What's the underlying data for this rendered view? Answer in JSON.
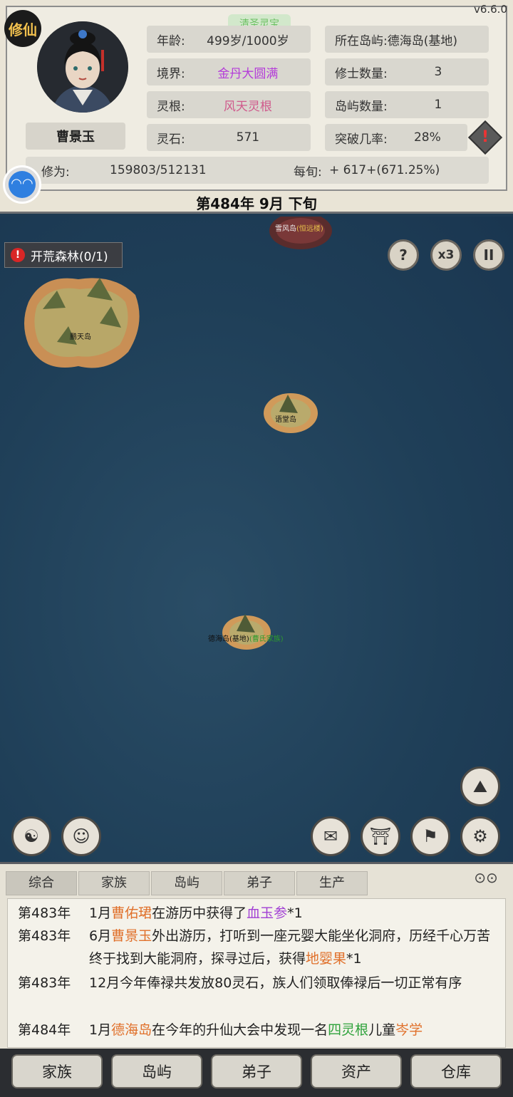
{
  "version": "v6.6.0",
  "logo": "修仙",
  "badge": "清圣灵宝",
  "character": {
    "name": "曹景玉",
    "age_label": "年龄:",
    "age_value": "499岁/1000岁",
    "realm_label": "境界:",
    "realm_value": "金丹大圆满",
    "root_label": "灵根:",
    "root_value": "风天灵根",
    "stones_label": "灵石:",
    "stones_value": "571",
    "cult_label": "修为:",
    "cult_value": "159803/512131",
    "per_label": "每旬:",
    "per_value": "+ 617+(671.25%)"
  },
  "island_info": {
    "location_label": "所在岛屿:",
    "location_value": "德海岛(基地)",
    "cultivators_label": "修士数量:",
    "cultivators_value": "3",
    "islands_label": "岛屿数量:",
    "islands_value": "1",
    "breakthrough_label": "突破几率:",
    "breakthrough_value": "28%"
  },
  "date": "第484年 9月 下旬",
  "quest": "开荒森林(0/1)",
  "map_controls": {
    "help": "?",
    "speed": "x3",
    "pause": "II"
  },
  "islands": {
    "north": "雪风岛",
    "north_tag": "(恒远楼)",
    "west": "鹏天岛",
    "mid": "语堂岛",
    "home": "德海岛(基地)",
    "home_tag": "(曹氏家族)"
  },
  "log_tabs": [
    "综合",
    "家族",
    "岛屿",
    "弟子",
    "生产"
  ],
  "log": [
    {
      "year": "第483年",
      "parts": [
        [
          "1月",
          ""
        ],
        [
          "曹佑珺",
          "orange"
        ],
        [
          "在游历中获得了",
          ""
        ],
        [
          "血玉参",
          "vio"
        ],
        [
          "*1",
          ""
        ]
      ]
    },
    {
      "year": "第483年",
      "parts": [
        [
          "6月",
          ""
        ],
        [
          "曹景玉",
          "orange"
        ],
        [
          "外出游历，打听到一座元婴大能坐化洞府，历经千心万苦终于找到大能洞府，探寻过后，获得",
          ""
        ],
        [
          "地婴果",
          "orange"
        ],
        [
          "*1",
          ""
        ]
      ]
    },
    {
      "year": "第483年",
      "parts": [
        [
          "12月今年俸禄共发放80灵石，族人们领取俸禄后一切正常有序",
          ""
        ]
      ]
    },
    {
      "year": "第484年",
      "parts": [
        [
          "1月",
          ""
        ],
        [
          "德海岛",
          "orange"
        ],
        [
          "在今年的升仙大会中发现一名",
          ""
        ],
        [
          "四灵根",
          "grn"
        ],
        [
          "儿童",
          ""
        ],
        [
          "岑学",
          "orange"
        ]
      ]
    }
  ],
  "nav": [
    "家族",
    "岛屿",
    "弟子",
    "资产",
    "仓库"
  ]
}
